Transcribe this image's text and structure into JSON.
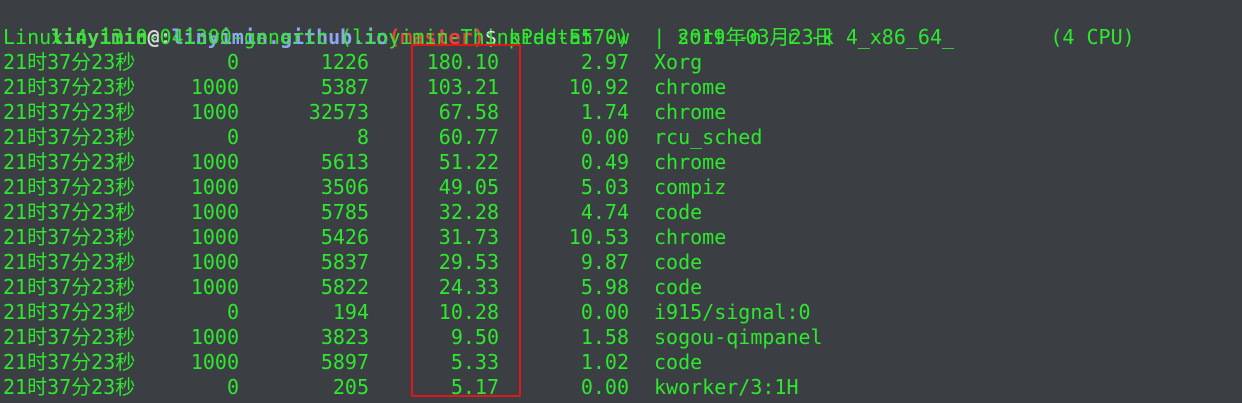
{
  "prompt": {
    "user": "linyimin",
    "at": "@",
    "colon": ":",
    "path": "linyimin.github.io",
    "branch": "(master)",
    "dollar": "$",
    "command": " pidstat -w  | sort -n -r -k 4"
  },
  "header_line": {
    "text": "Linux 4.13.0-041300-generic (linyimin-ThinkPad-E570)    2019年03月23日  _x86_64_        (4 CPU)"
  },
  "rows": [
    {
      "time": "21时37分23秒",
      "uid": "0",
      "pid": "1226",
      "cswch": "180.10",
      "nvcswch": "2.97",
      "command": "Xorg"
    },
    {
      "time": "21时37分23秒",
      "uid": "1000",
      "pid": "5387",
      "cswch": "103.21",
      "nvcswch": "10.92",
      "command": "chrome"
    },
    {
      "time": "21时37分23秒",
      "uid": "1000",
      "pid": "32573",
      "cswch": "67.58",
      "nvcswch": "1.74",
      "command": "chrome"
    },
    {
      "time": "21时37分23秒",
      "uid": "0",
      "pid": "8",
      "cswch": "60.77",
      "nvcswch": "0.00",
      "command": "rcu_sched"
    },
    {
      "time": "21时37分23秒",
      "uid": "1000",
      "pid": "5613",
      "cswch": "51.22",
      "nvcswch": "0.49",
      "command": "chrome"
    },
    {
      "time": "21时37分23秒",
      "uid": "1000",
      "pid": "3506",
      "cswch": "49.05",
      "nvcswch": "5.03",
      "command": "compiz"
    },
    {
      "time": "21时37分23秒",
      "uid": "1000",
      "pid": "5785",
      "cswch": "32.28",
      "nvcswch": "4.74",
      "command": "code"
    },
    {
      "time": "21时37分23秒",
      "uid": "1000",
      "pid": "5426",
      "cswch": "31.73",
      "nvcswch": "10.53",
      "command": "chrome"
    },
    {
      "time": "21时37分23秒",
      "uid": "1000",
      "pid": "5837",
      "cswch": "29.53",
      "nvcswch": "9.87",
      "command": "code"
    },
    {
      "time": "21时37分23秒",
      "uid": "1000",
      "pid": "5822",
      "cswch": "24.33",
      "nvcswch": "5.98",
      "command": "code"
    },
    {
      "time": "21时37分23秒",
      "uid": "0",
      "pid": "194",
      "cswch": "10.28",
      "nvcswch": "0.00",
      "command": "i915/signal:0"
    },
    {
      "time": "21时37分23秒",
      "uid": "1000",
      "pid": "3823",
      "cswch": "9.50",
      "nvcswch": "1.58",
      "command": "sogou-qimpanel"
    },
    {
      "time": "21时37分23秒",
      "uid": "1000",
      "pid": "5897",
      "cswch": "5.33",
      "nvcswch": "1.02",
      "command": "code"
    },
    {
      "time": "21时37分23秒",
      "uid": "0",
      "pid": "205",
      "cswch": "5.17",
      "nvcswch": "0.00",
      "command": "kworker/3:1H"
    }
  ],
  "colors": {
    "background": "#3b3f43",
    "text": "#2ee82e",
    "highlight": "#e01818",
    "branch": "#ef3e3e",
    "path": "#8fa6f2"
  }
}
